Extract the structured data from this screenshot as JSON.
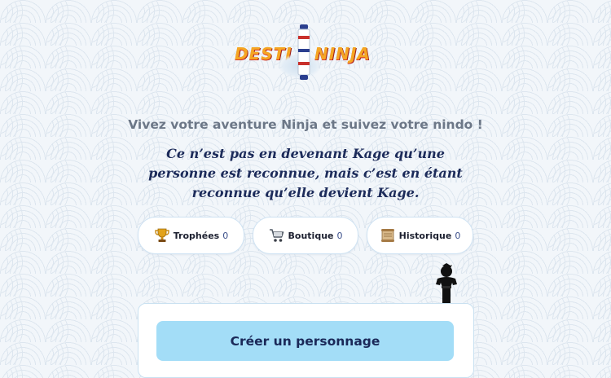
{
  "header": {
    "logo_left": "DESTI",
    "logo_right": "NINJA"
  },
  "tagline": "Vivez votre aventure Ninja et suivez votre nindo !",
  "quote": "Ce n’est pas en devenant Kage qu’une personne est reconnue, mais c’est en étant reconnue qu’elle devient Kage.",
  "stats": [
    {
      "label": "Trophées",
      "count": "0",
      "icon": "trophy-icon"
    },
    {
      "label": "Boutique",
      "count": "0",
      "icon": "cart-icon"
    },
    {
      "label": "Historique",
      "count": "0",
      "icon": "scroll-icon"
    }
  ],
  "card": {
    "create_label": "Créer un personnage"
  },
  "colors": {
    "accent_button": "#a3ddf7",
    "quote_text": "#1c2b5a",
    "tagline_text": "#6c7787"
  }
}
